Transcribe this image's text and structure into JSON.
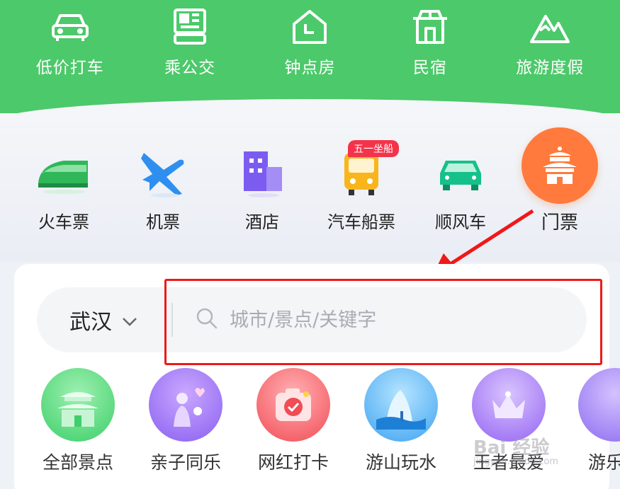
{
  "top_nav": [
    {
      "label": "低价打车",
      "icon": "car-icon"
    },
    {
      "label": "乘公交",
      "icon": "bus-card-icon"
    },
    {
      "label": "钟点房",
      "icon": "hourly-room-icon"
    },
    {
      "label": "民宿",
      "icon": "homestay-icon"
    },
    {
      "label": "旅游度假",
      "icon": "mountain-icon"
    }
  ],
  "services": [
    {
      "label": "火车票",
      "icon": "train-icon"
    },
    {
      "label": "机票",
      "icon": "plane-icon"
    },
    {
      "label": "酒店",
      "icon": "hotel-icon"
    },
    {
      "label": "汽车船票",
      "icon": "bus-icon",
      "badge": "五一坐船"
    },
    {
      "label": "顺风车",
      "icon": "carpool-icon"
    },
    {
      "label": "门票",
      "icon": "temple-ticket-icon"
    }
  ],
  "search": {
    "city": "武汉",
    "placeholder": "城市/景点/关键字"
  },
  "categories": [
    {
      "label": "全部景点"
    },
    {
      "label": "亲子同乐"
    },
    {
      "label": "网红打卡"
    },
    {
      "label": "游山玩水"
    },
    {
      "label": "王者最爱"
    },
    {
      "label": "游乐"
    }
  ],
  "watermark": {
    "text": "Bai 经验",
    "sub": "jingyan.baidu.com"
  },
  "colors": {
    "brand_green": "#4cc96a",
    "ticket_orange": "#ff7a3c",
    "highlight_red": "#f01818"
  }
}
